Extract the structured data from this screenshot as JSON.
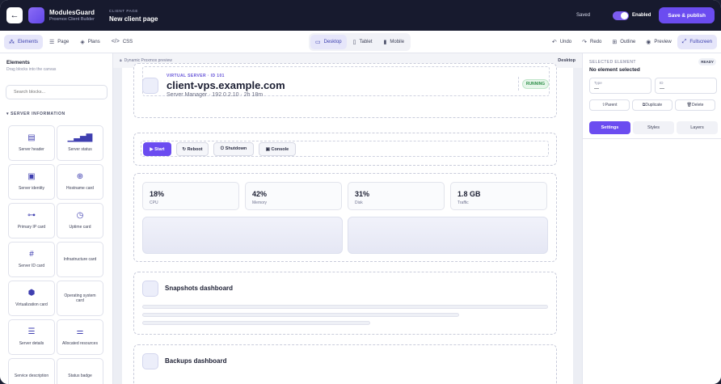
{
  "header": {
    "brand_title": "ModulesGuard",
    "brand_subtitle": "Proxmox Client Builder",
    "page_kicker": "CLIENT PAGE",
    "page_name": "New client page",
    "saved_status": "Saved",
    "enabled_label": "Enabled",
    "enabled_on": true,
    "publish_label": "Save & publish",
    "back_icon": "arrow-left-icon",
    "accent_color": "#6b4cf0"
  },
  "toolbar": {
    "left": [
      {
        "label": "Elements",
        "icon": "blocks-icon",
        "active": true
      },
      {
        "label": "Page",
        "icon": "page-icon",
        "active": false
      },
      {
        "label": "Plans",
        "icon": "plans-icon",
        "active": false
      },
      {
        "label": "CSS",
        "icon": "code-icon",
        "active": false
      }
    ],
    "devices": [
      {
        "label": "Desktop",
        "icon": "desktop-icon",
        "active": true
      },
      {
        "label": "Tablet",
        "icon": "tablet-icon",
        "active": false
      },
      {
        "label": "Mobile",
        "icon": "mobile-icon",
        "active": false
      }
    ],
    "right": [
      {
        "label": "Undo",
        "icon": "undo-icon",
        "active": false
      },
      {
        "label": "Redo",
        "icon": "redo-icon",
        "active": false
      },
      {
        "label": "Outline",
        "icon": "outline-icon",
        "active": false
      },
      {
        "label": "Preview",
        "icon": "eye-icon",
        "active": false
      },
      {
        "label": "Fullscreen",
        "icon": "fullscreen-icon",
        "active": true
      }
    ]
  },
  "sidebar": {
    "title": "Elements",
    "subtitle": "Drag blocks into the canvas",
    "search_placeholder": "Search blocks...",
    "section": "SERVER INFORMATION",
    "blocks": [
      {
        "label": "Server header",
        "icon": "server-header-icon"
      },
      {
        "label": "Server status",
        "icon": "signal-bars-icon"
      },
      {
        "label": "Server identity",
        "icon": "id-card-icon"
      },
      {
        "label": "Hostname card",
        "icon": "globe-icon"
      },
      {
        "label": "Primary IP card",
        "icon": "network-icon"
      },
      {
        "label": "Uptime card",
        "icon": "clock-icon"
      },
      {
        "label": "Server ID card",
        "icon": "hash-icon"
      },
      {
        "label": "Infrastructure card",
        "icon": ""
      },
      {
        "label": "Virtualization card",
        "icon": "cubes-icon"
      },
      {
        "label": "Operating system card",
        "icon": ""
      },
      {
        "label": "Server details",
        "icon": "list-icon"
      },
      {
        "label": "Allocated resources",
        "icon": "sliders-icon"
      },
      {
        "label": "Service description",
        "icon": ""
      },
      {
        "label": "Status badge",
        "icon": ""
      }
    ]
  },
  "canvas": {
    "preview_label": "Dynamic Proxmox preview",
    "device_label": "Desktop",
    "server": {
      "kicker": "VIRTUAL SERVER · ID 101",
      "hostname": "client-vps.example.com",
      "meta": "Server Manager · 192.0.2.10 · 2h 18m",
      "status": "RUNNING"
    },
    "actions": [
      {
        "label": "▶ Start",
        "primary": true
      },
      {
        "label": "↻ Reboot",
        "primary": false
      },
      {
        "label": "⏻ Shutdown",
        "primary": false
      },
      {
        "label": "▣ Console",
        "primary": false
      }
    ],
    "stats": [
      {
        "value": "18%",
        "label": "CPU"
      },
      {
        "value": "42%",
        "label": "Memory"
      },
      {
        "value": "31%",
        "label": "Disk"
      },
      {
        "value": "1.8 GB",
        "label": "Traffic"
      }
    ],
    "snapshots_title": "Snapshots dashboard",
    "backups_title": "Backups dashboard"
  },
  "panel": {
    "kicker": "SELECTED ELEMENT",
    "ready": "READY",
    "title": "No element selected",
    "type_label": "Type",
    "type_value": "—",
    "id_label": "ID",
    "id_value": "—",
    "buttons": [
      "⇧Parent",
      "⧉Duplicate",
      "🗑Delete"
    ],
    "tabs": [
      {
        "label": "Settings",
        "active": true
      },
      {
        "label": "Styles",
        "active": false
      },
      {
        "label": "Layers",
        "active": false
      }
    ]
  }
}
